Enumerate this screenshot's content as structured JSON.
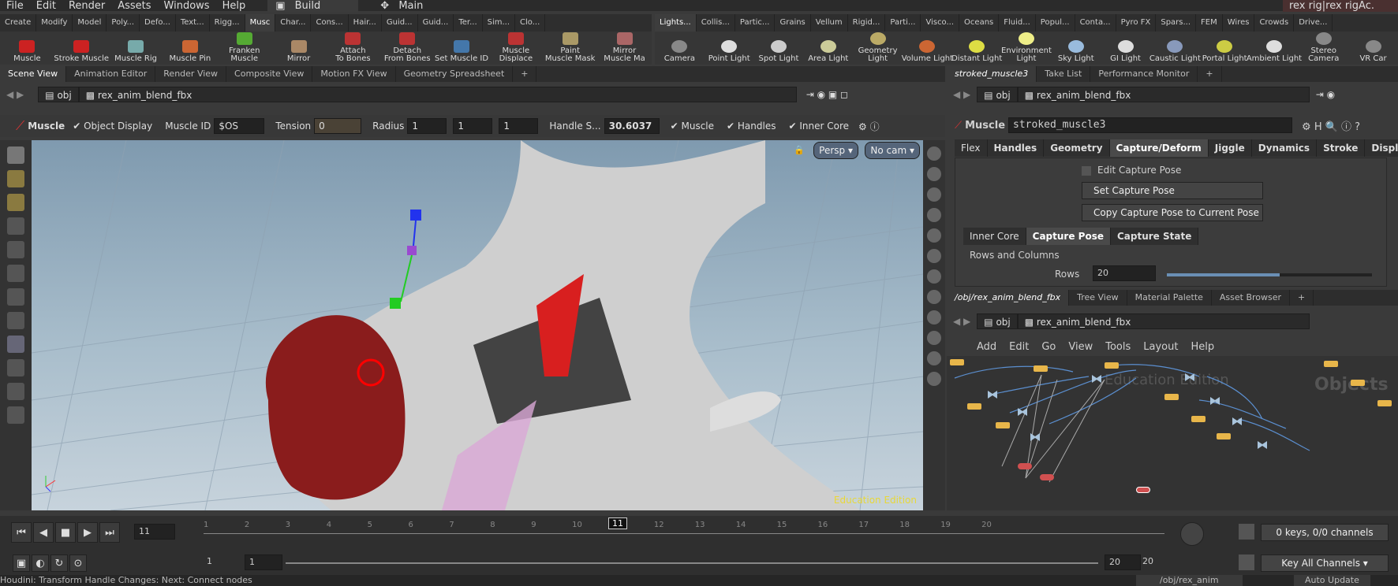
{
  "menu": [
    "File",
    "Edit",
    "Render",
    "Assets",
    "Windows",
    "Help"
  ],
  "desktop": "Build",
  "main_label": "Main",
  "window_title": "rex rig|rex rigAc.",
  "left_shelf_tabs": [
    "Create",
    "Modify",
    "Model",
    "Poly...",
    "Defo...",
    "Text...",
    "Rigg...",
    "Musc",
    "Char...",
    "Cons...",
    "Hair...",
    "Guid...",
    "Guid...",
    "Ter...",
    "Sim...",
    "Clo..."
  ],
  "left_shelf_tools": [
    "Muscle",
    "Stroke Muscle",
    "Muscle Rig",
    "Muscle Pin",
    "Franken\nMuscle",
    "Mirror",
    "Attach\nTo Bones",
    "Detach\nFrom Bones",
    "Set Muscle ID",
    "Muscle\nDisplace",
    "Paint\nMuscle Mask",
    "Mirror\nMuscle Ma"
  ],
  "right_shelf_tabs": [
    "Lights...",
    "Collis...",
    "Partic...",
    "Grains",
    "Vellum",
    "Rigid...",
    "Parti...",
    "Visco...",
    "Oceans",
    "Fluid...",
    "Popul...",
    "Conta...",
    "Pyro FX",
    "Spars...",
    "FEM",
    "Wires",
    "Crowds",
    "Drive..."
  ],
  "right_shelf_tools": [
    "Camera",
    "Point Light",
    "Spot Light",
    "Area Light",
    "Geometry\nLight",
    "Volume Light",
    "Distant Light",
    "Environment\nLight",
    "Sky Light",
    "GI Light",
    "Caustic Light",
    "Portal Light",
    "Ambient Light",
    "Stereo\nCamera",
    "VR Car"
  ],
  "left_pane_tabs": [
    "Scene View",
    "Animation Editor",
    "Render View",
    "Composite View",
    "Motion FX View",
    "Geometry Spreadsheet"
  ],
  "path_obj": "obj",
  "path_node": "rex_anim_blend_fbx",
  "opbar": {
    "tool": "Muscle",
    "object_display": "Object Display",
    "muscle_id_label": "Muscle ID",
    "muscle_id": "$OS",
    "tension_label": "Tension",
    "tension": "0",
    "radius_label": "Radius",
    "radius_vals": [
      "1",
      "1",
      "1"
    ],
    "handle_label": "Handle S...",
    "handle_val": "30.6037",
    "muscle_chk": "Muscle",
    "handles_chk": "Handles",
    "inner_core_chk": "Inner Core"
  },
  "viewport": {
    "persp": "Persp",
    "cam": "No cam",
    "watermark": "Education Edition"
  },
  "param_tabs_top": [
    "stroked_muscle3",
    "Take List",
    "Performance Monitor"
  ],
  "param": {
    "type": "Muscle",
    "name": "stroked_muscle3",
    "tabs": [
      "Flex",
      "Handles",
      "Geometry",
      "Capture/Deform",
      "Jiggle",
      "Dynamics",
      "Stroke",
      "Display"
    ],
    "edit_capture": "Edit Capture Pose",
    "set_capture": "Set Capture Pose",
    "copy_capture": "Copy Capture Pose to Current Pose",
    "subtabs": [
      "Inner Core",
      "Capture Pose",
      "Capture State"
    ],
    "rows_cols": "Rows and Columns",
    "rows_label": "Rows",
    "rows_val": "20",
    "rows_frac": 0.55
  },
  "net_tabs": [
    "/obj/rex_anim_blend_fbx",
    "Tree View",
    "Material Palette",
    "Asset Browser"
  ],
  "net_menu": [
    "Add",
    "Edit",
    "Go",
    "View",
    "Tools",
    "Layout",
    "Help"
  ],
  "net_watermark": "Education Edition",
  "net_obj": "Objects",
  "timeline": {
    "frame": "11",
    "ticks": [
      "1",
      "2",
      "3",
      "4",
      "5",
      "6",
      "7",
      "8",
      "9",
      "10",
      "11",
      "12",
      "13",
      "14",
      "15",
      "16",
      "17",
      "18",
      "19",
      "20"
    ],
    "current": "11",
    "start": "1",
    "start2": "1",
    "end": "20",
    "end2": "20",
    "keys": "0 keys, 0/0 channels",
    "key_all": "Key All Channels"
  },
  "status": "Houdini: Transform Handle Changes: Next: Connect nodes",
  "status_path": "/obj/rex_anim",
  "auto_update": "Auto Update"
}
